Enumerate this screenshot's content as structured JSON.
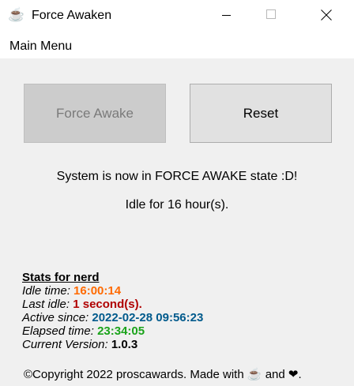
{
  "window": {
    "title": "Force Awaken",
    "app_icon": "coffee-cup-icon"
  },
  "menu": {
    "main_menu_label": "Main Menu"
  },
  "buttons": {
    "force_awake_label": "Force Awake",
    "force_awake_enabled": false,
    "reset_label": "Reset"
  },
  "status": {
    "state_text": "System is now in FORCE AWAKE state :D!",
    "idle_text": "Idle for 16 hour(s)."
  },
  "stats": {
    "title": "Stats for nerd",
    "idle_time_label": "Idle time:",
    "idle_time_value": "16:00:14",
    "last_idle_label": "Last idle:",
    "last_idle_value": "1 second(s).",
    "active_since_label": "Active since:",
    "active_since_value": "2022-02-28 09:56:23",
    "elapsed_time_label": "Elapsed time:",
    "elapsed_time_value": "23:34:05",
    "version_label": "Current Version:",
    "version_value": "1.0.3"
  },
  "footer": {
    "copyright_prefix": "©Copyright 2022 proscawards. Made with ",
    "copyright_middle": " and ",
    "copyright_suffix": ".",
    "coffee_glyph": "☕",
    "heart_glyph": "❤"
  },
  "colors": {
    "idle_time": "#ff6a00",
    "last_idle": "#b00000",
    "active_since": "#005a8c",
    "elapsed_time": "#1aa31a",
    "version": "#000000"
  }
}
